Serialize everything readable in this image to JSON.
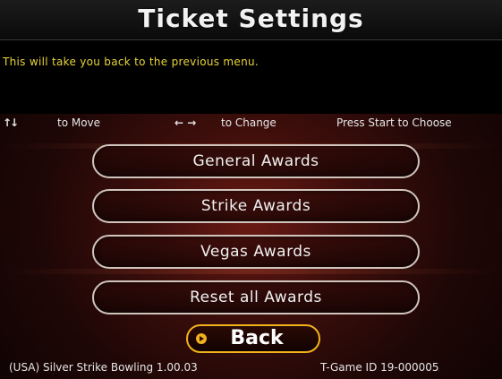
{
  "screen": {
    "title": "Ticket Settings",
    "info_text": "This will take you back to the previous menu."
  },
  "help": {
    "move_icon": "↑↓",
    "move_label": "to Move",
    "change_icon": "← →",
    "change_label": "to Change",
    "start_label": "Press Start to Choose"
  },
  "menu": {
    "items": [
      {
        "label": "General Awards"
      },
      {
        "label": "Strike Awards"
      },
      {
        "label": "Vegas Awards"
      },
      {
        "label": "Reset all Awards"
      }
    ],
    "back_label": "Back",
    "selected": "Back"
  },
  "footer": {
    "game_info": "(USA) Silver Strike Bowling 1.00.03",
    "game_id": "T-Game ID 19-000005"
  },
  "colors": {
    "info_text": "#e8d33a",
    "selected_border": "#f1b21c",
    "button_border": "#d0c4bd"
  }
}
